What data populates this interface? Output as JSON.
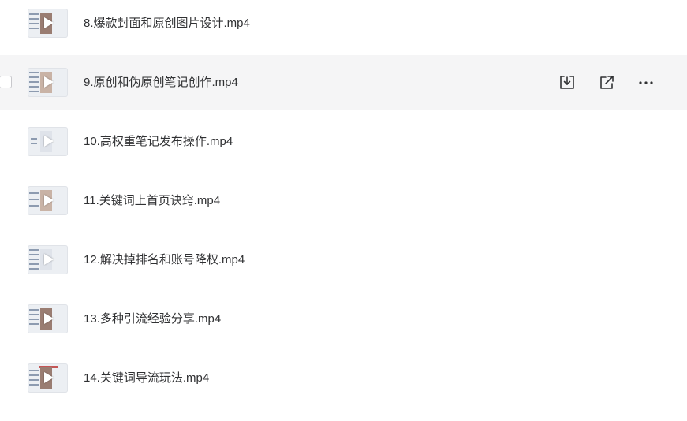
{
  "file_list": {
    "items": [
      {
        "name": "8.爆款封面和原创图片设计.mp4",
        "type": "video",
        "icon": "play-icon",
        "thumb_variant": "a"
      },
      {
        "name": "9.原创和伪原创笔记创作.mp4",
        "type": "video",
        "icon": "play-icon",
        "thumb_variant": "b",
        "hovered": true
      },
      {
        "name": "10.高权重笔记发布操作.mp4",
        "type": "video",
        "icon": "play-icon",
        "thumb_variant": "c"
      },
      {
        "name": "11.关键词上首页诀窍.mp4",
        "type": "video",
        "icon": "play-icon",
        "thumb_variant": "d"
      },
      {
        "name": "12.解决掉排名和账号降权.mp4",
        "type": "video",
        "icon": "play-icon",
        "thumb_variant": "e"
      },
      {
        "name": "13.多种引流经验分享.mp4",
        "type": "video",
        "icon": "play-icon",
        "thumb_variant": "f"
      },
      {
        "name": "14.关键词导流玩法.mp4",
        "type": "video",
        "icon": "play-icon",
        "thumb_variant": "g"
      }
    ],
    "row_actions": [
      {
        "name": "download",
        "icon": "download-icon"
      },
      {
        "name": "share",
        "icon": "share-icon"
      },
      {
        "name": "more",
        "icon": "more-icon"
      }
    ]
  },
  "colors": {
    "hover_background": "#f5f5f6",
    "text": "#303133",
    "icon": "#303133"
  }
}
